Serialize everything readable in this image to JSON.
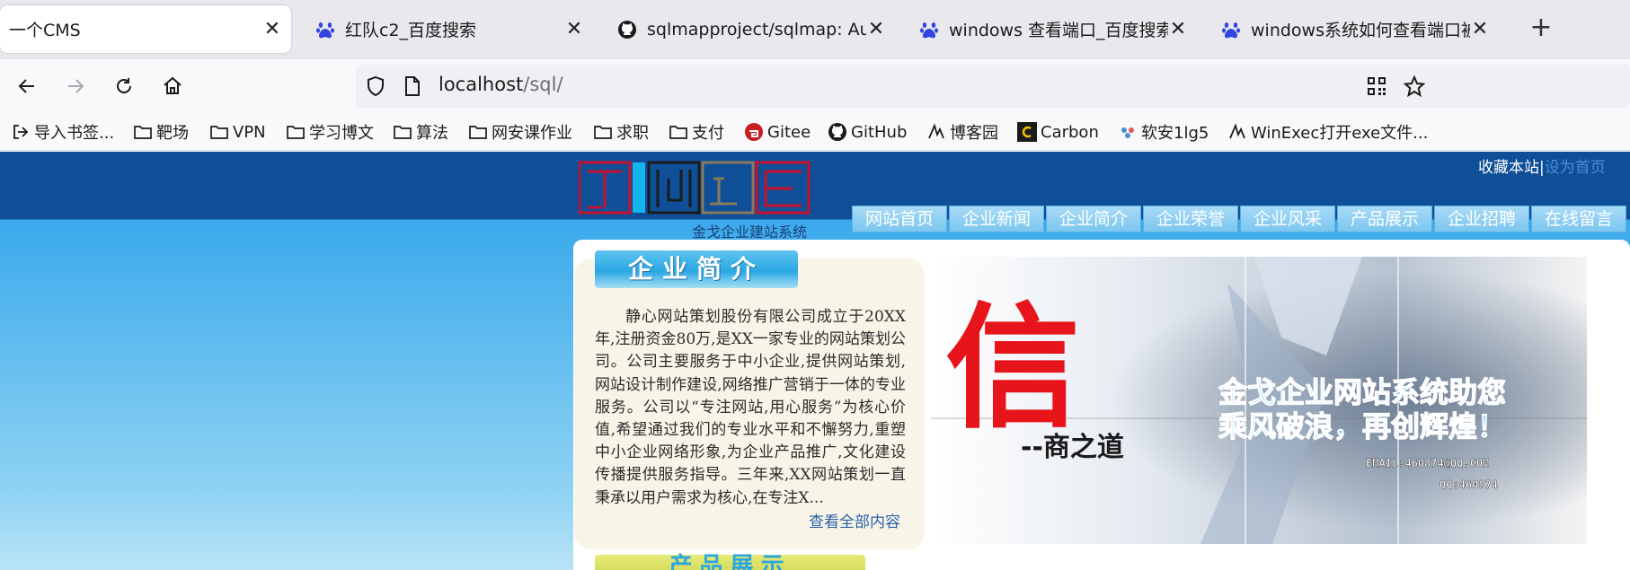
{
  "tabs": [
    {
      "title": "一个CMS",
      "icon": "none",
      "active": true
    },
    {
      "title": "红队c2_百度搜索",
      "icon": "baidu-paw-icon"
    },
    {
      "title": "sqlmapproject/sqlmap: Automatic SQL injection",
      "icon": "github-icon"
    },
    {
      "title": "windows 查看端口_百度搜索",
      "icon": "baidu-paw-icon"
    },
    {
      "title": "windows系统如何查看端口被占用",
      "icon": "baidu-paw-icon"
    }
  ],
  "address": {
    "host": "localhost",
    "path": "/sql/"
  },
  "bookmarks": [
    {
      "label": "导入书签...",
      "icon": "import-icon"
    },
    {
      "label": "靶场",
      "icon": "folder-icon"
    },
    {
      "label": "VPN",
      "icon": "folder-icon"
    },
    {
      "label": "学习博文",
      "icon": "folder-icon"
    },
    {
      "label": "算法",
      "icon": "folder-icon"
    },
    {
      "label": "网安课作业",
      "icon": "folder-icon"
    },
    {
      "label": "求职",
      "icon": "folder-icon"
    },
    {
      "label": "支付",
      "icon": "folder-icon"
    },
    {
      "label": "Gitee",
      "icon": "gitee-icon"
    },
    {
      "label": "GitHub",
      "icon": "github-icon"
    },
    {
      "label": "博客园",
      "icon": "cnblogs-icon"
    },
    {
      "label": "Carbon",
      "icon": "carbon-icon"
    },
    {
      "label": "软安1lg5",
      "icon": "link-icon"
    },
    {
      "label": "WinExec打开exe文件...",
      "icon": "cnblogs-icon"
    }
  ],
  "site": {
    "logo_sub": "金戈企业建站系统",
    "favorite": "收藏本站",
    "separator": "|",
    "sethome": "设为首页",
    "menu": [
      "网站首页",
      "企业新闻",
      "企业简介",
      "企业荣誉",
      "企业风采",
      "产品展示",
      "企业招聘",
      "在线留言"
    ],
    "intro_title": "企业简介",
    "intro_text": "静心网站策划股份有限公司成立于20XX年,注册资金80万,是XX一家专业的网站策划公司。公司主要服务于中小企业,提供网站策划,网站设计制作建设,网络推广营销于一体的专业服务。公司以“专注网站,用心服务”为核心价值,希望通过我们的专业水平和不懈努力,重塑中小企业网络形象,为企业产品推广,文化建设传播提供服务指导。三年来,XX网站策划一直秉承以用户需求为核心,在专注X...",
    "readmore": "查看全部内容",
    "product_title": "产品展示",
    "banner": {
      "big_char": "信",
      "subtitle": "--商之道",
      "slogan_1": "金戈企业网站系统助您",
      "slogan_2": "乘风破浪，再创辉煌！",
      "email": "EMAIL:460874@QQ.COM",
      "qq": "QQ:460874"
    }
  }
}
